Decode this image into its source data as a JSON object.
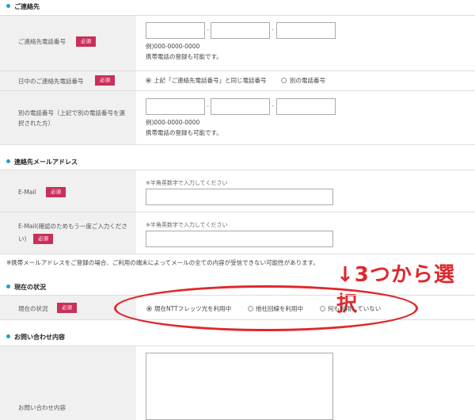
{
  "sections": {
    "contact": "ご連絡先",
    "email": "連絡先メールアドレス",
    "status": "現在の状況",
    "inquiry": "お問い合わせ内容"
  },
  "required_label": "必須",
  "phone_separator": "-",
  "contact_phone": {
    "label": "ご連絡先電話番号",
    "example": "例)000-0000-0000",
    "mobile_note": "携帯電話の登録も可能です。"
  },
  "daytime_phone": {
    "label": "日中のご連絡先電話番号",
    "options": [
      "上記「ご連絡先電話番号」と同じ電話番号",
      "別の電話番号"
    ],
    "selected": 0
  },
  "other_phone": {
    "label_line1": "別の電話番号（上記で別の電話番号を選",
    "label_line2": "択された方）",
    "example": "例)000-0000-0000",
    "mobile_note": "携帯電話の登録も可能です。"
  },
  "email": {
    "label": "E-Mail",
    "hint": "※半角英数字で入力してください",
    "confirm_label_line1": "E-Mail(確認のためもう一度ご入力くださ",
    "confirm_label_line2": "い)",
    "confirm_hint": "※半角英数字で入力してください"
  },
  "carrier_note": "※携帯メールアドレスをご登録の場合、ご利用の端末によってメールの全ての内容が受信できない可能性があります。",
  "annotation": "↓3つから選択",
  "annotation_color": "#e0282c",
  "current_status": {
    "label": "現在の状況",
    "options": [
      "現在NTTフレッツ光を利用中",
      "他社回線を利用中",
      "何も利用していない"
    ],
    "selected": 0
  },
  "inquiry": {
    "label": "お問い合わせ内容"
  },
  "colors": {
    "accent_dot": "#20a0c8",
    "required_badge": "#c8305a",
    "label_bg": "#f0f0f0"
  }
}
